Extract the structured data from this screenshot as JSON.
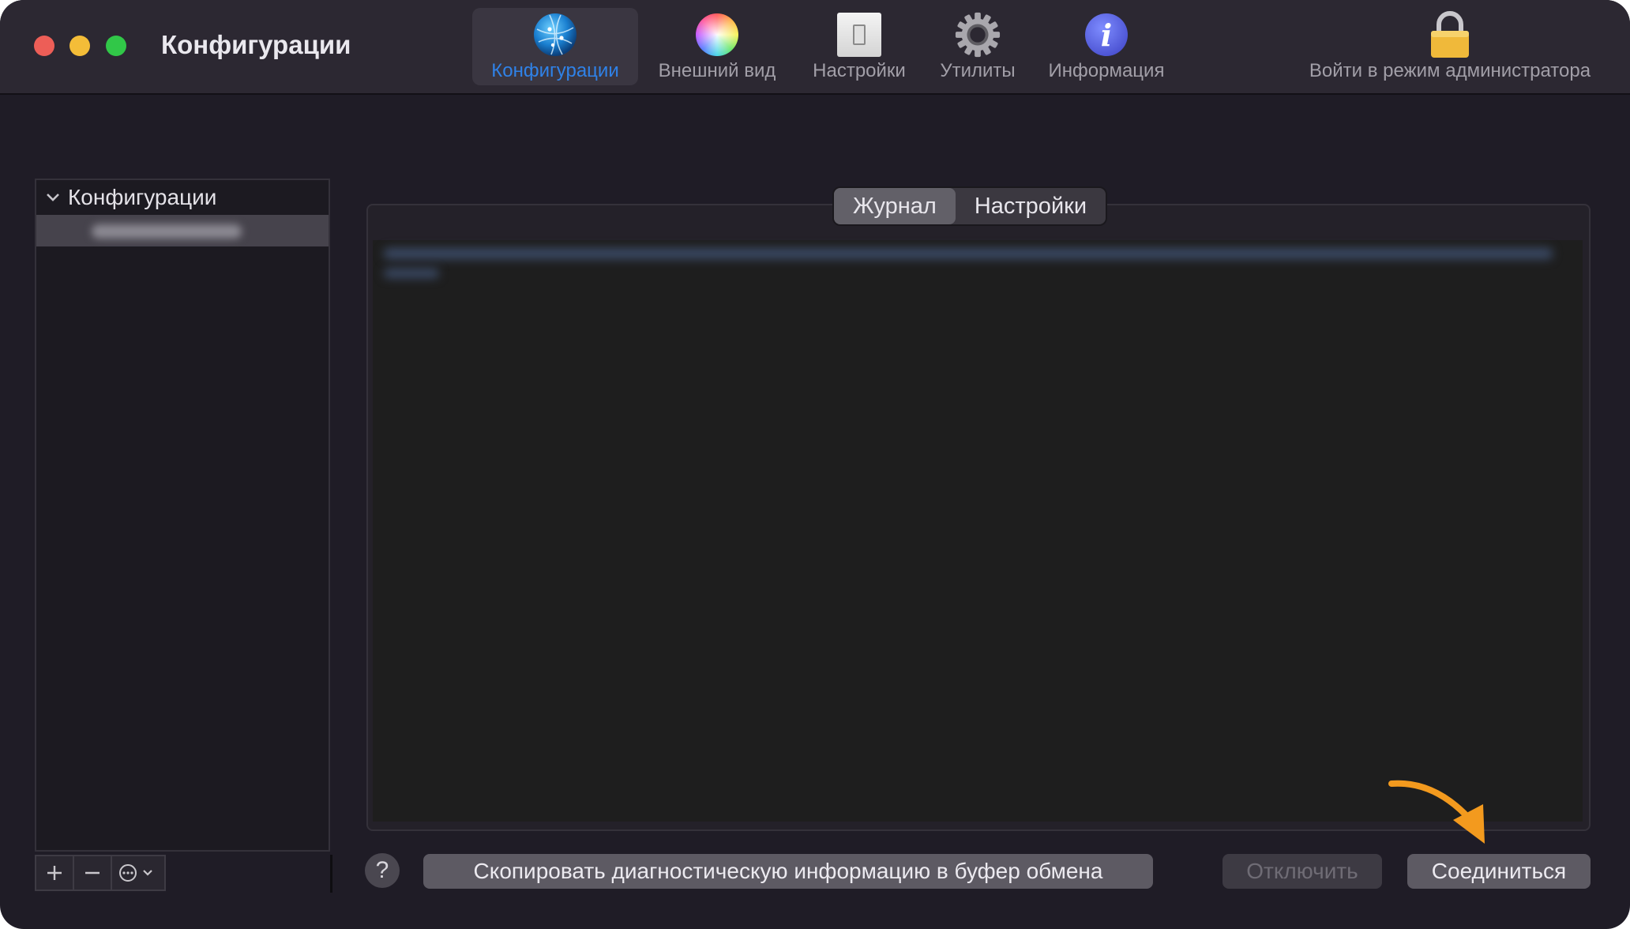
{
  "window": {
    "title": "Конфигурации"
  },
  "toolbar": {
    "items": [
      {
        "label": "Конфигурации",
        "icon": "globe-icon",
        "selected": true
      },
      {
        "label": "Внешний вид",
        "icon": "color-wheel-icon",
        "selected": false
      },
      {
        "label": "Настройки",
        "icon": "switch-icon",
        "selected": false
      },
      {
        "label": "Утилиты",
        "icon": "gear-icon",
        "selected": false
      },
      {
        "label": "Информация",
        "icon": "info-icon",
        "selected": false
      }
    ],
    "admin": {
      "label": "Войти в режим администратора",
      "icon": "lock-icon"
    }
  },
  "sidebar": {
    "section_title": "Конфигурации",
    "items": [
      {
        "label_blurred": true
      }
    ],
    "add_icon": "plus-icon",
    "remove_icon": "minus-icon",
    "more_icon": "ellipsis-circle-icon"
  },
  "tabs": {
    "items": [
      {
        "label": "Журнал",
        "active": true
      },
      {
        "label": "Настройки",
        "active": false
      }
    ]
  },
  "bottom": {
    "help_label": "?",
    "copy_label": "Скопировать диагностическую информацию в буфер обмена",
    "disconnect_label": "Отключить",
    "connect_label": "Соединиться"
  },
  "colors": {
    "accent": "#2f82e8",
    "annotation_arrow": "#f39a1e",
    "window_bg": "#1f1c26"
  }
}
